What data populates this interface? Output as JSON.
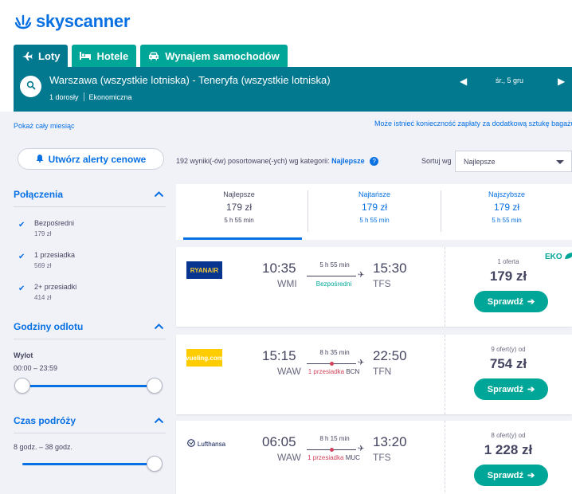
{
  "brand": {
    "name": "skyscanner",
    "color": "#0770e3"
  },
  "tabs": [
    {
      "label": "Loty",
      "icon": "plane-icon",
      "active": true
    },
    {
      "label": "Hotele",
      "icon": "bed-icon",
      "active": false
    },
    {
      "label": "Wynajem samochodów",
      "icon": "car-icon",
      "active": false
    }
  ],
  "search": {
    "route": "Warszawa (wszystkie lotniska) - Teneryfa (wszystkie lotniska)",
    "passengers": "1 dorosły",
    "cabin": "Ekonomiczna",
    "date": "śr., 5 gru"
  },
  "links": {
    "month": "Pokaż cały miesiąc",
    "baggage": "Może istnieć konieczność zapłaty za dodatkową sztukę bagażu"
  },
  "alert_button": "Utwórz alerty cenowe",
  "filters": {
    "connections": {
      "title": "Połączenia",
      "items": [
        {
          "label": "Bezpośredni",
          "price": "179 zł"
        },
        {
          "label": "1 przesiadka",
          "price": "569 zł"
        },
        {
          "label": "2+ przesiadki",
          "price": "414 zł"
        }
      ]
    },
    "departure": {
      "title": "Godziny odlotu",
      "label": "Wylot",
      "range": "00:00 – 23:59"
    },
    "duration": {
      "title": "Czas podróży",
      "range": "8 godz. – 38 godz."
    }
  },
  "results": {
    "count_text": "192 wyniki(-ów) posortowane(-ych) wg kategorii:",
    "sort_category": "Najlepsze",
    "sort_label": "Sortuj wg",
    "sort_value": "Najlepsze"
  },
  "sort_tabs": [
    {
      "title": "Najlepsze",
      "price": "179 zł",
      "duration": "5 h 55 min",
      "active": true
    },
    {
      "title": "Najtańsze",
      "price": "179 zł",
      "duration": "5 h 55 min",
      "active": false
    },
    {
      "title": "Najszybsze",
      "price": "179 zł",
      "duration": "5 h 55 min",
      "active": false
    }
  ],
  "flights": [
    {
      "airline": "RYANAIR",
      "dep_time": "10:35",
      "dep_code": "WMI",
      "arr_time": "15:30",
      "arr_code": "TFS",
      "duration": "5 h 55 min",
      "stops": "Bezpośredni",
      "stop_airport": "",
      "offers": "1 oferta",
      "price": "179 zł",
      "button": "Sprawdź",
      "eco": "EKO"
    },
    {
      "airline": "vueling.com",
      "dep_time": "15:15",
      "dep_code": "WAW",
      "arr_time": "22:50",
      "arr_code": "TFN",
      "duration": "8 h 35 min",
      "stops": "1 przesiadka",
      "stop_airport": "BCN",
      "offers": "9 ofert(y) od",
      "price": "754 zł",
      "button": "Sprawdź"
    },
    {
      "airline": "Lufthansa",
      "dep_time": "06:05",
      "dep_code": "WAW",
      "arr_time": "13:20",
      "arr_code": "TFS",
      "duration": "8 h 15 min",
      "stops": "1 przesiadka",
      "stop_airport": "MUC",
      "offers": "8 ofert(y) od",
      "price": "1 228 zł",
      "button": "Sprawdź"
    }
  ],
  "colors": {
    "teal": "#00a698",
    "dark_teal": "#02798f",
    "blue": "#0770e3",
    "red": "#d1435b"
  }
}
